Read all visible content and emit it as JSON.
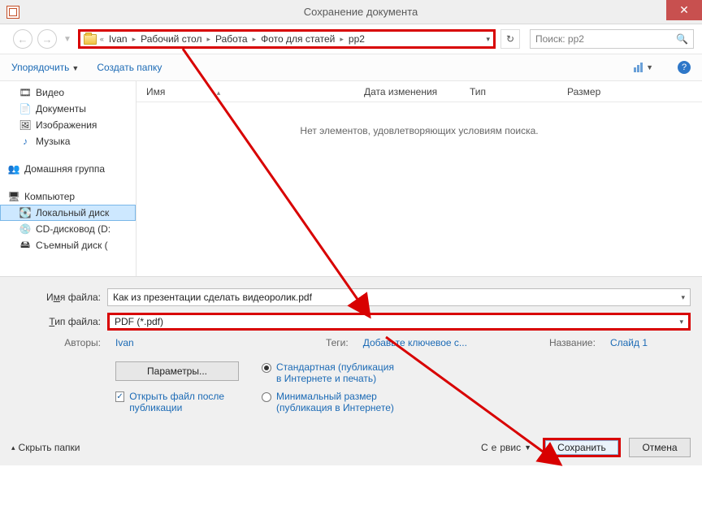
{
  "window": {
    "title": "Сохранение документа"
  },
  "breadcrumb": {
    "prefix": "«",
    "items": [
      "Ivan",
      "Рабочий стол",
      "Работа",
      "Фото для статей",
      "pp2"
    ]
  },
  "search": {
    "placeholder": "Поиск: pp2"
  },
  "toolbar": {
    "organize": "Упорядочить",
    "new_folder": "Создать папку"
  },
  "tree": {
    "video": "Видео",
    "docs": "Документы",
    "images": "Изображения",
    "music": "Музыка",
    "homegroup": "Домашняя группа",
    "computer": "Компьютер",
    "local_disk": "Локальный диск",
    "cd": "CD-дисковод (D:",
    "removable": "Съемный диск ("
  },
  "columns": {
    "name": "Имя",
    "date": "Дата изменения",
    "type": "Тип",
    "size": "Размер"
  },
  "empty": "Нет элементов, удовлетворяющих условиям поиска.",
  "form": {
    "filename_label_pre": "И",
    "filename_label_u": "м",
    "filename_label_post": "я файла:",
    "filename_value": "Как из презентации сделать видеоролик.pdf",
    "filetype_label_pre": "",
    "filetype_label_u": "Т",
    "filetype_label_post": "ип файла:",
    "filetype_value": "PDF (*.pdf)"
  },
  "meta": {
    "authors_label": "Авторы:",
    "authors_value": "Ivan",
    "tags_label": "Теги:",
    "tags_value": "Добавьте ключевое с...",
    "title_label": "Название:",
    "title_value": "Слайд 1"
  },
  "options": {
    "params_button_u": "П",
    "params_button_post": "араметры...",
    "open_after_pre": "Открыть ф",
    "open_after_u": "а",
    "open_after_post": "йл после публикации",
    "standard_u": "С",
    "standard_post": "тандартная (публикация в Интернете и печать)",
    "minimal_u": "М",
    "minimal_post": "инимальный размер (публикация в Интернете)"
  },
  "footer": {
    "hide_folders": "Скрыть папки",
    "service_pre": "С",
    "service_u": "е",
    "service_post": "рвис",
    "save_u": "С",
    "save_post": "охранить",
    "cancel": "Отмена"
  }
}
